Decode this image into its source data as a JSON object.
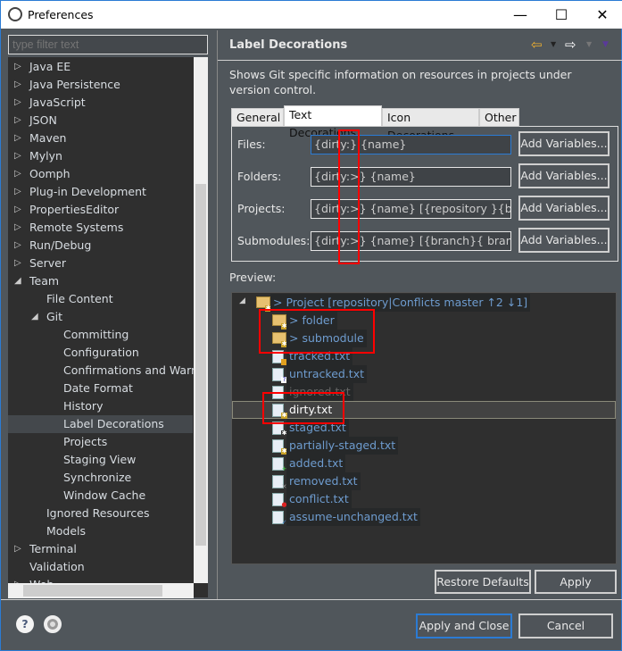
{
  "window": {
    "title": "Preferences",
    "minimize": "—",
    "maximize": "☐",
    "close": "✕"
  },
  "filter": {
    "placeholder": "type filter text"
  },
  "nav": [
    {
      "label": "Java EE",
      "level": 0,
      "arrow": "▷"
    },
    {
      "label": "Java Persistence",
      "level": 0,
      "arrow": "▷"
    },
    {
      "label": "JavaScript",
      "level": 0,
      "arrow": "▷"
    },
    {
      "label": "JSON",
      "level": 0,
      "arrow": "▷"
    },
    {
      "label": "Maven",
      "level": 0,
      "arrow": "▷"
    },
    {
      "label": "Mylyn",
      "level": 0,
      "arrow": "▷"
    },
    {
      "label": "Oomph",
      "level": 0,
      "arrow": "▷"
    },
    {
      "label": "Plug-in Development",
      "level": 0,
      "arrow": "▷"
    },
    {
      "label": "PropertiesEditor",
      "level": 0,
      "arrow": "▷"
    },
    {
      "label": "Remote Systems",
      "level": 0,
      "arrow": "▷"
    },
    {
      "label": "Run/Debug",
      "level": 0,
      "arrow": "▷"
    },
    {
      "label": "Server",
      "level": 0,
      "arrow": "▷"
    },
    {
      "label": "Team",
      "level": 0,
      "arrow": "◢"
    },
    {
      "label": "File Content",
      "level": 1,
      "arrow": ""
    },
    {
      "label": "Git",
      "level": 1,
      "arrow": "◢"
    },
    {
      "label": "Committing",
      "level": 2,
      "arrow": ""
    },
    {
      "label": "Configuration",
      "level": 2,
      "arrow": ""
    },
    {
      "label": "Confirmations and Warnings",
      "level": 2,
      "arrow": ""
    },
    {
      "label": "Date Format",
      "level": 2,
      "arrow": ""
    },
    {
      "label": "History",
      "level": 2,
      "arrow": ""
    },
    {
      "label": "Label Decorations",
      "level": 2,
      "arrow": "",
      "selected": true
    },
    {
      "label": "Projects",
      "level": 2,
      "arrow": ""
    },
    {
      "label": "Staging View",
      "level": 2,
      "arrow": ""
    },
    {
      "label": "Synchronize",
      "level": 2,
      "arrow": ""
    },
    {
      "label": "Window Cache",
      "level": 2,
      "arrow": ""
    },
    {
      "label": "Ignored Resources",
      "level": 1,
      "arrow": ""
    },
    {
      "label": "Models",
      "level": 1,
      "arrow": ""
    },
    {
      "label": "Terminal",
      "level": 0,
      "arrow": "▷"
    },
    {
      "label": "Validation",
      "level": 0,
      "arrow": ""
    },
    {
      "label": "Web",
      "level": 0,
      "arrow": "▷"
    }
  ],
  "page": {
    "title": "Label Decorations",
    "description": "Shows Git specific information on resources in projects under version control."
  },
  "tabs": [
    "General",
    "Text Decorations",
    "Icon Decorations",
    "Other"
  ],
  "active_tab": "Text Decorations",
  "fields": [
    {
      "label": "Files:",
      "value": "{dirty:} {name}",
      "button": "Add Variables..."
    },
    {
      "label": "Folders:",
      "value": "{dirty:>} {name}",
      "button": "Add Variables..."
    },
    {
      "label": "Projects:",
      "value": "{dirty:>} {name} [{repository }{branch}{ branch_status}]",
      "button": "Add Variables..."
    },
    {
      "label": "Submodules:",
      "value": "{dirty:>} {name} [{branch}{ branch_status}]",
      "button": "Add Variables..."
    }
  ],
  "preview_label": "Preview:",
  "preview": [
    {
      "label": "> Project [repository|Conflicts master ↑2 ↓1]",
      "type": "project",
      "level": 0
    },
    {
      "label": "> folder",
      "type": "folder",
      "level": 1,
      "overlay": "dirty"
    },
    {
      "label": "> submodule",
      "type": "folder",
      "level": 1,
      "overlay": "dirty"
    },
    {
      "label": "tracked.txt",
      "type": "file",
      "level": 1,
      "overlay": "tracked"
    },
    {
      "label": "untracked.txt",
      "type": "file",
      "level": 1,
      "overlay": "untracked"
    },
    {
      "label": "ignored.txt",
      "type": "file",
      "level": 1,
      "overlay": "ignored"
    },
    {
      "label": "dirty.txt",
      "type": "file",
      "level": 1,
      "overlay": "dirty",
      "selected": true
    },
    {
      "label": "staged.txt",
      "type": "file",
      "level": 1,
      "overlay": "staged"
    },
    {
      "label": "partially-staged.txt",
      "type": "file",
      "level": 1,
      "overlay": "partial"
    },
    {
      "label": "added.txt",
      "type": "file",
      "level": 1,
      "overlay": "added"
    },
    {
      "label": "removed.txt",
      "type": "file",
      "level": 1,
      "overlay": "removed"
    },
    {
      "label": "conflict.txt",
      "type": "file",
      "level": 1,
      "overlay": "conflict"
    },
    {
      "label": "assume-unchanged.txt",
      "type": "file",
      "level": 1,
      "overlay": "assume"
    }
  ],
  "buttons": {
    "restore": "Restore Defaults",
    "apply": "Apply",
    "apply_close": "Apply and Close",
    "cancel": "Cancel"
  },
  "colors": {
    "annotation": "#ff0000",
    "accent": "#2b7bd4",
    "preview_text": "#6e9ccf"
  }
}
